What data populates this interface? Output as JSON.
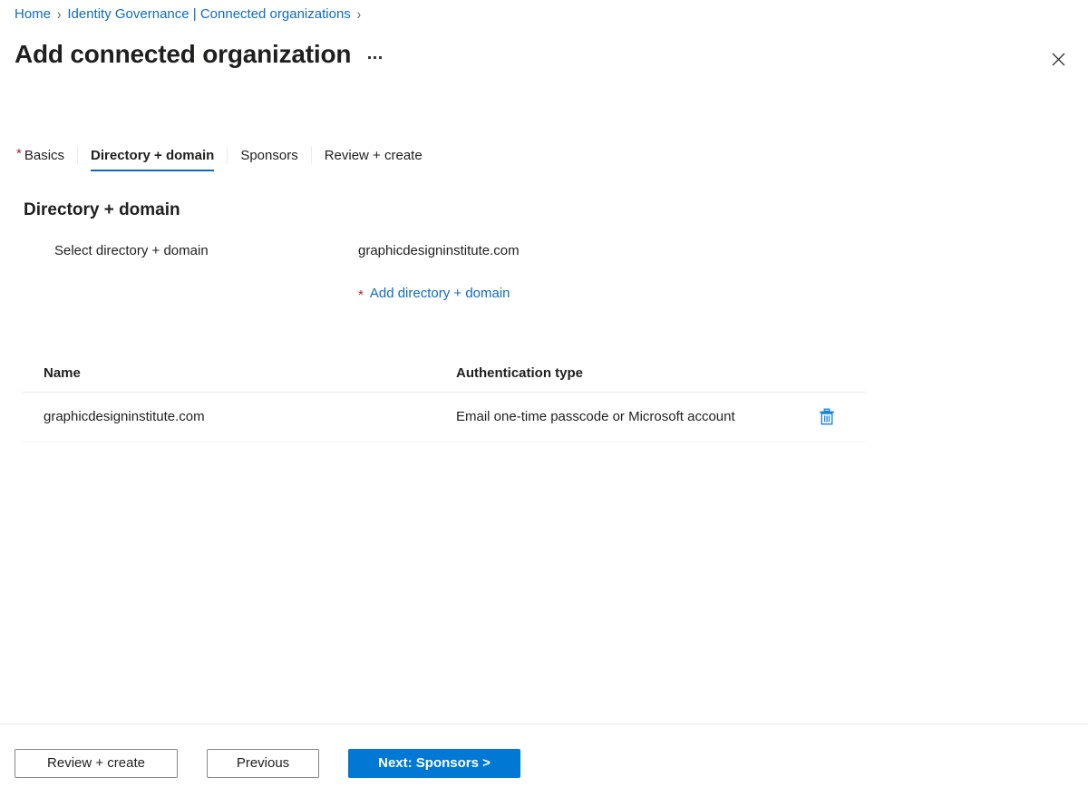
{
  "breadcrumb": {
    "items": [
      {
        "label": "Home"
      },
      {
        "label": "Identity Governance | Connected organizations"
      }
    ],
    "separator": "›"
  },
  "header": {
    "title": "Add connected organization",
    "more_menu_name": "more-commands",
    "close_label": "Close"
  },
  "tabs": [
    {
      "label": "Basics",
      "required": true,
      "active": false
    },
    {
      "label": "Directory + domain",
      "required": false,
      "active": true
    },
    {
      "label": "Sponsors",
      "required": false,
      "active": false
    },
    {
      "label": "Review + create",
      "required": false,
      "active": false
    }
  ],
  "section": {
    "heading": "Directory + domain",
    "field_label": "Select directory + domain",
    "field_value": "graphicdesigninstitute.com",
    "add_link_star": "*",
    "add_link_label": "Add directory + domain"
  },
  "grid": {
    "columns": [
      "Name",
      "Authentication type",
      ""
    ],
    "rows": [
      {
        "name": "graphicdesigninstitute.com",
        "auth_type": "Email one-time passcode or Microsoft account",
        "delete_icon": "trash-icon"
      }
    ]
  },
  "footer": {
    "review_create_label": "Review + create",
    "previous_label": "Previous",
    "next_label": "Next: Sponsors >"
  },
  "colors": {
    "link": "#0f6cbd",
    "primary": "#0078d4",
    "required": "#a4262c",
    "icon_blue": "#1a85d6",
    "border": "#edebe9"
  }
}
